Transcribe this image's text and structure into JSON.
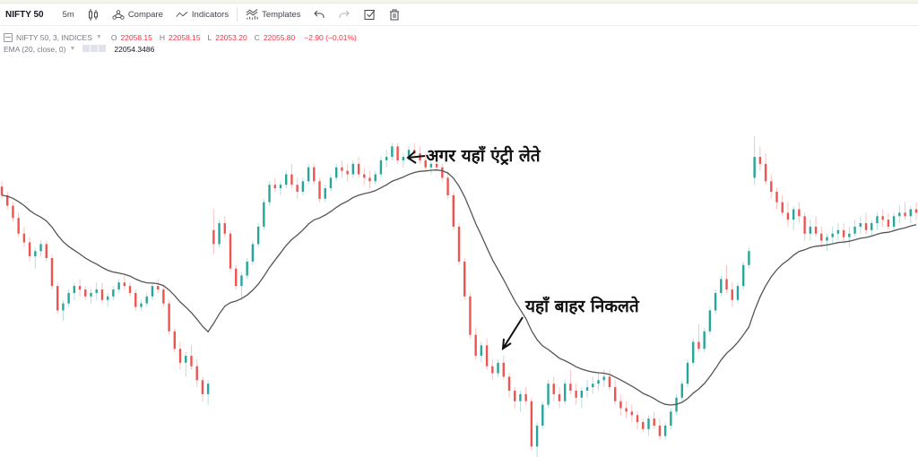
{
  "toolbar": {
    "symbol": "NIFTY 50",
    "interval": "5m",
    "chart_type_icon": "candles-icon",
    "compare_label": "Compare",
    "indicators_label": "Indicators",
    "templates_label": "Templates",
    "undo_icon": "undo-icon",
    "redo_icon": "redo-icon",
    "save_icon": "checkbox-icon",
    "delete_icon": "trash-icon"
  },
  "legend": {
    "series_title": "NIFTY 50, 3, INDICES",
    "open_label": "O",
    "open": "22058.15",
    "high_label": "H",
    "high": "22058.15",
    "low_label": "L",
    "low": "22053.20",
    "close_label": "C",
    "close": "22055.80",
    "change": "−2.90 (−0.01%)",
    "indicator_title": "EMA (20, close, 0)",
    "indicator_value": "22054.3486"
  },
  "colors": {
    "up": "#26a69a",
    "down": "#ef5350",
    "ema": "#555555",
    "annotation": "#111111"
  },
  "annotations": [
    {
      "text": "अगर यहाँ एंट्री लेते",
      "meaning": "entry"
    },
    {
      "text": "यहाँ बाहर निकलते",
      "meaning": "exit"
    }
  ],
  "chart_data": {
    "type": "candlestick",
    "title": "NIFTY 50, 3, INDICES",
    "indicator": "EMA (20, close, 0)",
    "ylim": [
      21940,
      22130
    ],
    "grid": false,
    "gaps_after_index": [
      37,
      138
    ],
    "candles": [
      [
        22095,
        22098,
        22088,
        22090
      ],
      [
        22090,
        22092,
        22082,
        22084
      ],
      [
        22084,
        22086,
        22075,
        22077
      ],
      [
        22077,
        22080,
        22066,
        22068
      ],
      [
        22068,
        22072,
        22060,
        22063
      ],
      [
        22063,
        22066,
        22052,
        22055
      ],
      [
        22055,
        22060,
        22048,
        22058
      ],
      [
        22058,
        22064,
        22055,
        22062
      ],
      [
        22062,
        22064,
        22052,
        22054
      ],
      [
        22054,
        22056,
        22036,
        22038
      ],
      [
        22038,
        22040,
        22022,
        22024
      ],
      [
        22024,
        22030,
        22018,
        22028
      ],
      [
        22028,
        22036,
        22026,
        22034
      ],
      [
        22034,
        22040,
        22030,
        22038
      ],
      [
        22038,
        22042,
        22032,
        22036
      ],
      [
        22036,
        22038,
        22030,
        22032
      ],
      [
        22032,
        22036,
        22028,
        22034
      ],
      [
        22034,
        22040,
        22030,
        22036
      ],
      [
        22036,
        22040,
        22028,
        22030
      ],
      [
        22030,
        22034,
        22026,
        22032
      ],
      [
        22032,
        22038,
        22030,
        22036
      ],
      [
        22036,
        22042,
        22034,
        22040
      ],
      [
        22040,
        22044,
        22036,
        22038
      ],
      [
        22038,
        22040,
        22032,
        22034
      ],
      [
        22034,
        22036,
        22024,
        22026
      ],
      [
        22026,
        22030,
        22024,
        22028
      ],
      [
        22028,
        22034,
        22026,
        22032
      ],
      [
        22032,
        22040,
        22030,
        22038
      ],
      [
        22038,
        22042,
        22034,
        22036
      ],
      [
        22036,
        22038,
        22026,
        22028
      ],
      [
        22028,
        22030,
        22010,
        22012
      ],
      [
        22012,
        22014,
        22000,
        22002
      ],
      [
        22002,
        22006,
        21990,
        21994
      ],
      [
        21994,
        22000,
        21986,
        21998
      ],
      [
        21998,
        22004,
        21990,
        21992
      ],
      [
        21992,
        21996,
        21980,
        21984
      ],
      [
        21984,
        21986,
        21972,
        21976
      ],
      [
        21976,
        21984,
        21970,
        21982
      ],
      [
        22070,
        22082,
        22056,
        22062
      ],
      [
        22062,
        22076,
        22060,
        22074
      ],
      [
        22074,
        22078,
        22066,
        22068
      ],
      [
        22068,
        22070,
        22046,
        22048
      ],
      [
        22048,
        22050,
        22036,
        22038
      ],
      [
        22038,
        22046,
        22030,
        22044
      ],
      [
        22044,
        22054,
        22042,
        22052
      ],
      [
        22052,
        22064,
        22050,
        22062
      ],
      [
        22062,
        22074,
        22060,
        22072
      ],
      [
        22072,
        22088,
        22070,
        22086
      ],
      [
        22086,
        22098,
        22084,
        22096
      ],
      [
        22096,
        22100,
        22092,
        22094
      ],
      [
        22094,
        22098,
        22090,
        22096
      ],
      [
        22096,
        22104,
        22094,
        22102
      ],
      [
        22102,
        22108,
        22094,
        22096
      ],
      [
        22096,
        22100,
        22088,
        22092
      ],
      [
        22092,
        22100,
        22090,
        22098
      ],
      [
        22098,
        22108,
        22096,
        22106
      ],
      [
        22106,
        22108,
        22096,
        22098
      ],
      [
        22098,
        22100,
        22086,
        22088
      ],
      [
        22088,
        22096,
        22086,
        22094
      ],
      [
        22094,
        22102,
        22092,
        22100
      ],
      [
        22100,
        22108,
        22098,
        22106
      ],
      [
        22106,
        22110,
        22100,
        22104
      ],
      [
        22104,
        22108,
        22098,
        22102
      ],
      [
        22102,
        22110,
        22100,
        22108
      ],
      [
        22108,
        22112,
        22100,
        22102
      ],
      [
        22102,
        22106,
        22096,
        22100
      ],
      [
        22100,
        22104,
        22094,
        22098
      ],
      [
        22098,
        22104,
        22096,
        22102
      ],
      [
        22102,
        22112,
        22100,
        22110
      ],
      [
        22110,
        22116,
        22106,
        22112
      ],
      [
        22112,
        22120,
        22110,
        22118
      ],
      [
        22118,
        22120,
        22108,
        22110
      ],
      [
        22110,
        22114,
        22106,
        22112
      ],
      [
        22112,
        22118,
        22110,
        22116
      ],
      [
        22116,
        22120,
        22112,
        22114
      ],
      [
        22114,
        22118,
        22108,
        22110
      ],
      [
        22110,
        22114,
        22104,
        22106
      ],
      [
        22106,
        22110,
        22102,
        22108
      ],
      [
        22108,
        22112,
        22104,
        22106
      ],
      [
        22106,
        22108,
        22098,
        22100
      ],
      [
        22100,
        22104,
        22088,
        22090
      ],
      [
        22090,
        22092,
        22070,
        22072
      ],
      [
        22072,
        22074,
        22050,
        22052
      ],
      [
        22052,
        22054,
        22030,
        22032
      ],
      [
        22032,
        22034,
        22008,
        22010
      ],
      [
        22010,
        22014,
        21996,
        21998
      ],
      [
        21998,
        22006,
        21994,
        22004
      ],
      [
        22004,
        22008,
        21990,
        21992
      ],
      [
        21992,
        21996,
        21984,
        21988
      ],
      [
        21988,
        21996,
        21986,
        21994
      ],
      [
        21994,
        21998,
        21984,
        21986
      ],
      [
        21986,
        21988,
        21974,
        21978
      ],
      [
        21978,
        21980,
        21968,
        21972
      ],
      [
        21972,
        21978,
        21966,
        21976
      ],
      [
        21976,
        21980,
        21970,
        21972
      ],
      [
        21972,
        21974,
        21944,
        21946
      ],
      [
        21946,
        21960,
        21940,
        21958
      ],
      [
        21958,
        21972,
        21956,
        21970
      ],
      [
        21970,
        21984,
        21968,
        21982
      ],
      [
        21982,
        21986,
        21972,
        21976
      ],
      [
        21976,
        21980,
        21968,
        21972
      ],
      [
        21972,
        21984,
        21970,
        21982
      ],
      [
        21982,
        21990,
        21976,
        21978
      ],
      [
        21978,
        21982,
        21970,
        21974
      ],
      [
        21974,
        21980,
        21968,
        21978
      ],
      [
        21978,
        21984,
        21974,
        21980
      ],
      [
        21980,
        21986,
        21976,
        21982
      ],
      [
        21982,
        21988,
        21978,
        21984
      ],
      [
        21984,
        21990,
        21980,
        21986
      ],
      [
        21986,
        21990,
        21978,
        21980
      ],
      [
        21980,
        21984,
        21970,
        21972
      ],
      [
        21972,
        21976,
        21964,
        21968
      ],
      [
        21968,
        21972,
        21962,
        21966
      ],
      [
        21966,
        21970,
        21960,
        21964
      ],
      [
        21964,
        21966,
        21956,
        21960
      ],
      [
        21960,
        21962,
        21954,
        21956
      ],
      [
        21956,
        21964,
        21952,
        21962
      ],
      [
        21962,
        21966,
        21956,
        21958
      ],
      [
        21958,
        21962,
        21950,
        21952
      ],
      [
        21952,
        21960,
        21950,
        21958
      ],
      [
        21958,
        21968,
        21956,
        21966
      ],
      [
        21966,
        21976,
        21964,
        21974
      ],
      [
        21974,
        21984,
        21972,
        21982
      ],
      [
        21982,
        21996,
        21980,
        21994
      ],
      [
        21994,
        22008,
        21992,
        22006
      ],
      [
        22006,
        22016,
        22000,
        22002
      ],
      [
        22002,
        22014,
        22000,
        22012
      ],
      [
        22012,
        22026,
        22010,
        22024
      ],
      [
        22024,
        22036,
        22022,
        22034
      ],
      [
        22034,
        22044,
        22032,
        22042
      ],
      [
        22042,
        22050,
        22034,
        22036
      ],
      [
        22036,
        22040,
        22026,
        22030
      ],
      [
        22030,
        22040,
        22028,
        22038
      ],
      [
        22038,
        22052,
        22036,
        22050
      ],
      [
        22050,
        22060,
        22048,
        22058
      ],
      [
        22100,
        22124,
        22096,
        22112
      ],
      [
        22112,
        22118,
        22104,
        22108
      ],
      [
        22108,
        22114,
        22096,
        22098
      ],
      [
        22098,
        22102,
        22088,
        22092
      ],
      [
        22092,
        22094,
        22082,
        22086
      ],
      [
        22086,
        22090,
        22078,
        22080
      ],
      [
        22080,
        22086,
        22072,
        22076
      ],
      [
        22076,
        22084,
        22070,
        22082
      ],
      [
        22082,
        22086,
        22074,
        22078
      ],
      [
        22078,
        22080,
        22064,
        22068
      ],
      [
        22068,
        22076,
        22064,
        22072
      ],
      [
        22072,
        22078,
        22066,
        22068
      ],
      [
        22068,
        22072,
        22060,
        22064
      ],
      [
        22064,
        22068,
        22058,
        22066
      ],
      [
        22066,
        22072,
        22062,
        22068
      ],
      [
        22068,
        22074,
        22064,
        22070
      ],
      [
        22070,
        22074,
        22062,
        22066
      ],
      [
        22066,
        22072,
        22060,
        22068
      ],
      [
        22068,
        22076,
        22066,
        22072
      ],
      [
        22072,
        22078,
        22068,
        22074
      ],
      [
        22074,
        22080,
        22068,
        22070
      ],
      [
        22070,
        22076,
        22066,
        22074
      ],
      [
        22074,
        22080,
        22070,
        22078
      ],
      [
        22078,
        22082,
        22072,
        22076
      ],
      [
        22076,
        22080,
        22070,
        22072
      ],
      [
        22072,
        22080,
        22070,
        22078
      ],
      [
        22078,
        22084,
        22074,
        22080
      ],
      [
        22080,
        22086,
        22076,
        22078
      ],
      [
        22078,
        22084,
        22074,
        22082
      ],
      [
        22082,
        22086,
        22076,
        22080
      ]
    ]
  }
}
